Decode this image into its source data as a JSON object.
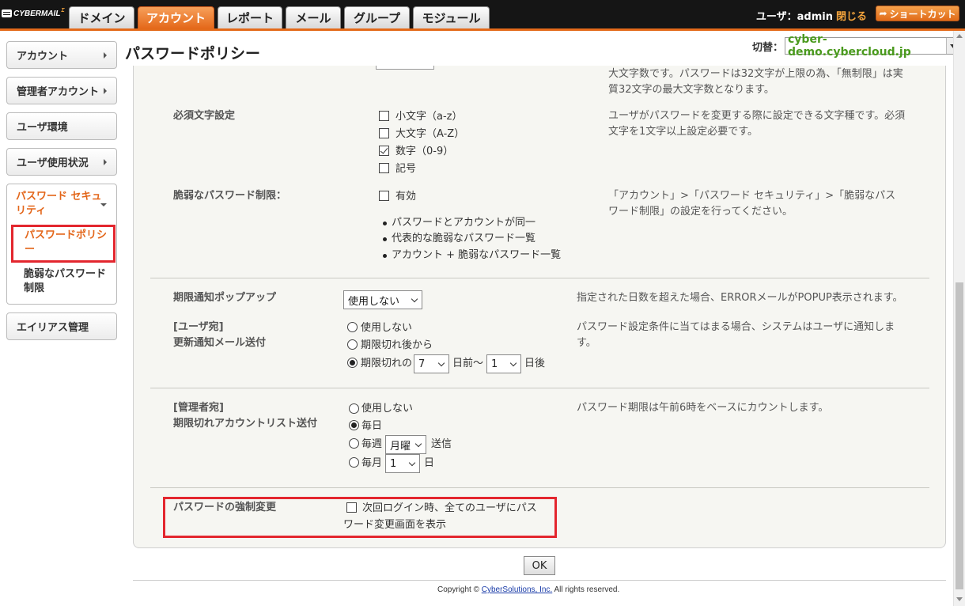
{
  "app": {
    "logo_text": "CYBERMAIL",
    "logo_sup": "Σ",
    "tabs": [
      "ドメイン",
      "アカウント",
      "レポート",
      "メール",
      "グループ",
      "モジュール"
    ],
    "active_tab": "アカウント",
    "user_label": "ユーザ：admin",
    "logout_label": "閉じる",
    "shortcut_label": "ショートカット",
    "accent_color": "#e36a1a",
    "highlight_color": "#e3262e"
  },
  "sidebar": {
    "items": [
      "アカウント",
      "管理者アカウント",
      "ユーザ環境",
      "ユーザ使用状況"
    ],
    "security": {
      "label": "パスワード セキュリティ",
      "sub_items": [
        "パスワードポリシー",
        "脆弱なパスワード制限"
      ]
    },
    "alias": "エイリアス管理"
  },
  "header": {
    "title": "パスワードポリシー",
    "switch_label": "切替：",
    "switch_value": "cyber-demo.cybercloud.jp"
  },
  "form": {
    "top_desc": "大文字数です。パスワードは32文字が上限の為、「無制限」は実質32文字の最大文字数となります。",
    "required_chars": {
      "label": "必須文字設定",
      "options": [
        {
          "label": "小文字（a-z）",
          "checked": false
        },
        {
          "label": "大文字（A-Z）",
          "checked": false
        },
        {
          "label": "数字（0-9）",
          "checked": true
        },
        {
          "label": "記号",
          "checked": false
        }
      ],
      "desc": "ユーザがパスワードを変更する際に設定できる文字種です。必須文字を1文字以上設定必要です。"
    },
    "weak_limit": {
      "label": "脆弱なパスワード制限：",
      "enable_label": "有効",
      "enabled": false,
      "bullets": [
        "パスワードとアカウントが同一",
        "代表的な脆弱なパスワード一覧",
        "アカウント + 脆弱なパスワード一覧"
      ],
      "desc": "「アカウント」>「パスワード セキュリティ」>「脆弱なパスワード制限」の設定を行ってください。"
    },
    "expiry_popup": {
      "label": "期限通知ポップアップ",
      "value": "使用しない",
      "desc": "指定された日数を超えた場合、ERRORメールがPOPUP表示されます。"
    },
    "user_notify": {
      "label_line1": "[ユーザ宛]",
      "label_line2": "更新通知メール送付",
      "options": [
        "使用しない",
        "期限切れ後から",
        "期限切れの"
      ],
      "selected": "期限切れの",
      "days_before": "7",
      "days_before_suffix": "日前〜",
      "days_after": "1",
      "days_after_suffix": "日後",
      "desc": "パスワード設定条件に当てはまる場合、システムはユーザに通知します。"
    },
    "admin_list": {
      "label_line1": "[管理者宛]",
      "label_line2": "期限切れアカウントリスト送付",
      "options": [
        "使用しない",
        "毎日",
        "毎週",
        "毎月"
      ],
      "selected": "毎日",
      "weekday": "月曜",
      "weekly_suffix": "送信",
      "monthday": "1",
      "monthly_suffix": "日",
      "desc": "パスワード期限は午前6時をベースにカウントします。"
    },
    "force_change": {
      "label": "パスワードの強制変更",
      "checkbox_label_line1": "次回ログイン時、全てのユーザにパス",
      "checkbox_label_line2": "ワード変更画面を表示",
      "checked": false
    }
  },
  "actions": {
    "ok_label": "OK"
  },
  "footer": {
    "prefix": "Copyright ©",
    "company": "CyberSolutions, Inc.",
    "suffix": "All rights reserved."
  }
}
